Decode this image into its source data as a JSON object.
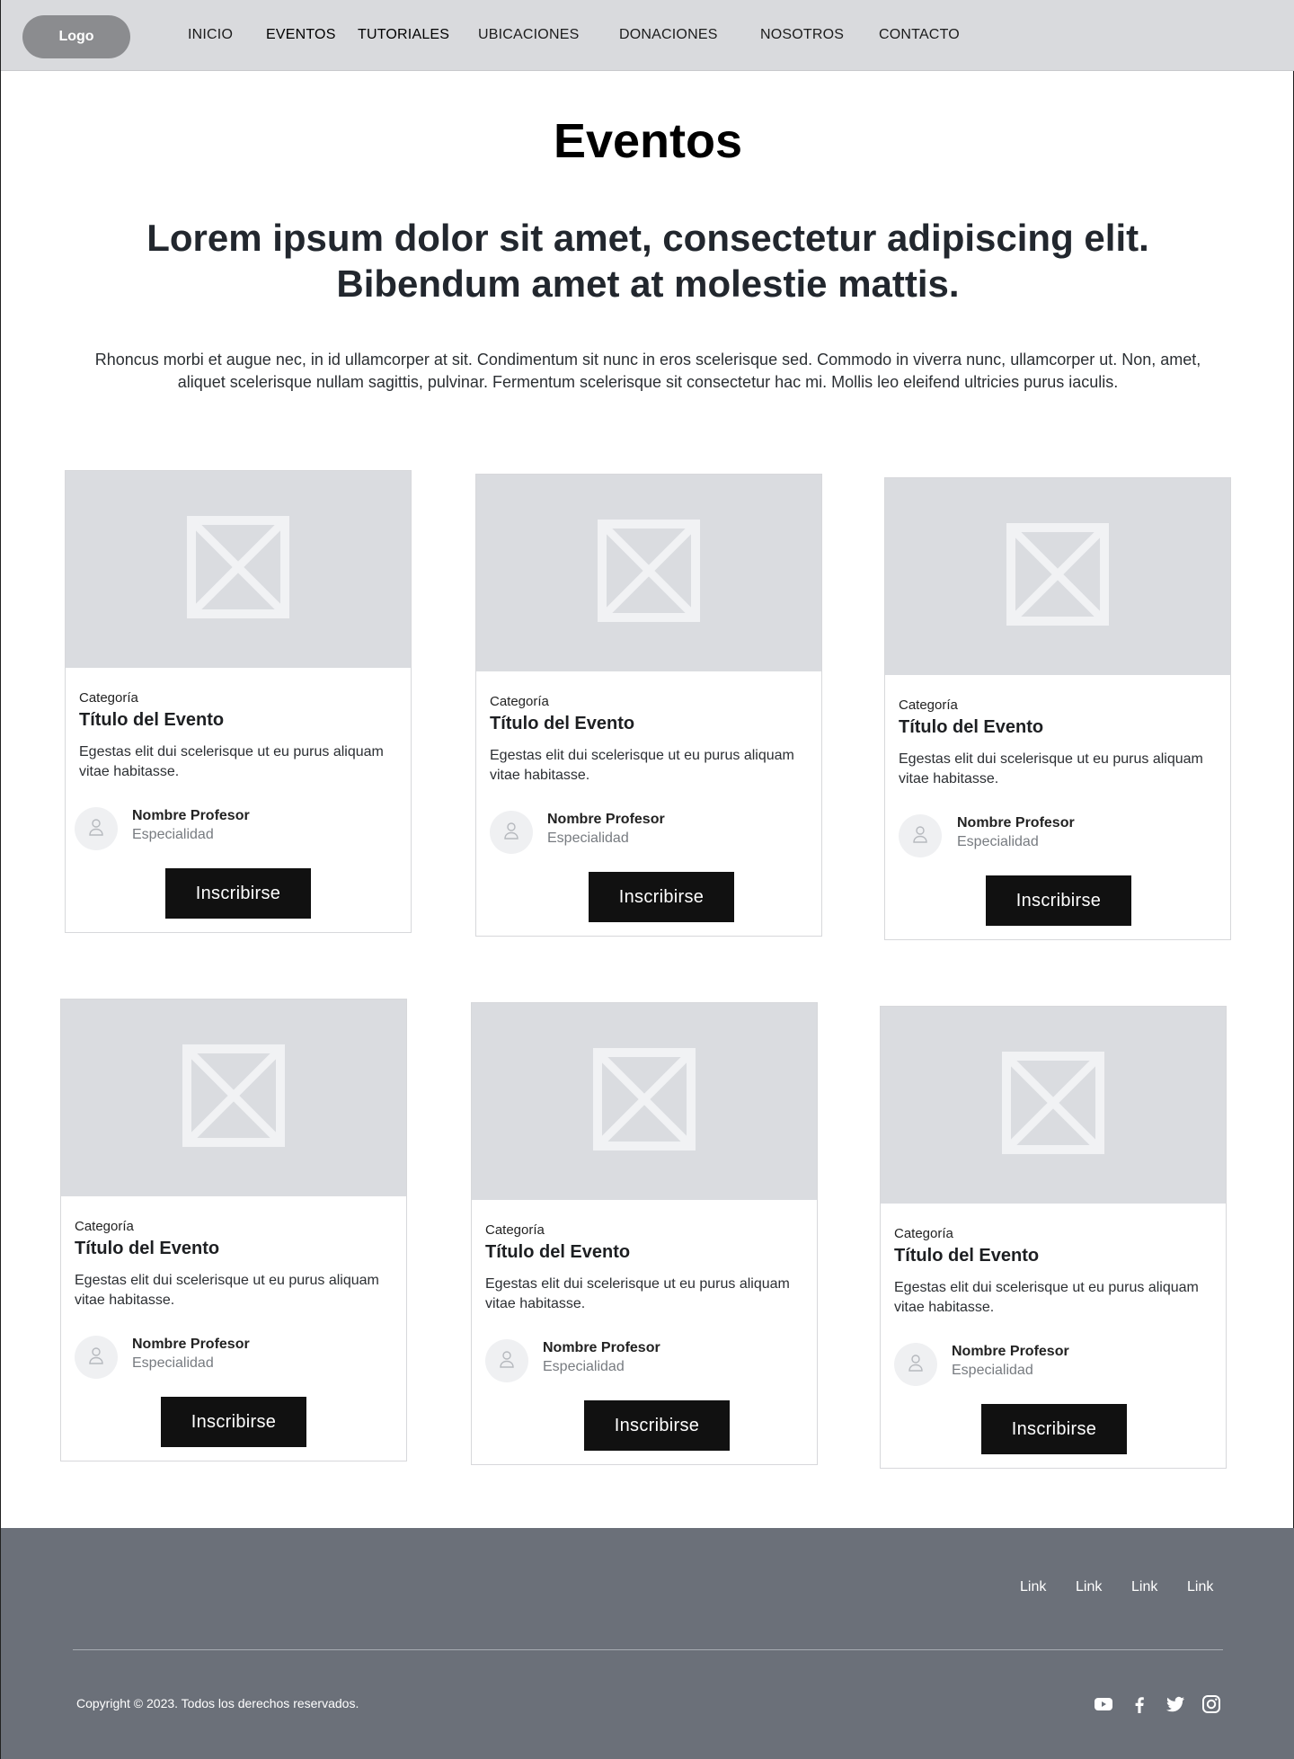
{
  "header": {
    "logo": "Logo",
    "nav": [
      "INICIO",
      "EVENTOS",
      "TUTORIALES",
      "UBICACIONES",
      "DONACIONES",
      "NOSOTROS",
      "CONTACTO"
    ]
  },
  "hero": {
    "title": "Eventos",
    "subtitle_line1": "Lorem ipsum dolor sit amet, consectetur adipiscing elit.",
    "subtitle_line2": "Bibendum amet at molestie mattis.",
    "intro_line1": "Rhoncus morbi et augue nec, in id ullamcorper at sit. Condimentum sit nunc in eros scelerisque sed. Commodo in viverra nunc, ullamcorper ut. Non, amet,",
    "intro_line2": "aliquet scelerisque nullam sagittis, pulvinar. Fermentum scelerisque sit consectetur hac mi. Mollis leo eleifend ultricies purus iaculis."
  },
  "cards": [
    {
      "category": "Categoría",
      "title": "Título del Evento",
      "desc_line1": "Egestas elit dui scelerisque ut eu purus aliquam",
      "desc_line2": "vitae habitasse.",
      "teacher": "Nombre Profesor",
      "specialty": "Especialidad",
      "button": "Inscribirse",
      "image_icon": "image-placeholder-icon",
      "avatar_icon": "user-icon"
    },
    {
      "category": "Categoría",
      "title": "Título del Evento",
      "desc_line1": "Egestas elit dui scelerisque ut eu purus aliquam",
      "desc_line2": "vitae habitasse.",
      "teacher": "Nombre Profesor",
      "specialty": "Especialidad",
      "button": "Inscribirse",
      "image_icon": "image-placeholder-icon",
      "avatar_icon": "user-icon"
    },
    {
      "category": "Categoría",
      "title": "Título del Evento",
      "desc_line1": "Egestas elit dui scelerisque ut eu purus aliquam",
      "desc_line2": "vitae habitasse.",
      "teacher": "Nombre Profesor",
      "specialty": "Especialidad",
      "button": "Inscribirse",
      "image_icon": "image-placeholder-icon",
      "avatar_icon": "user-icon"
    },
    {
      "category": "Categoría",
      "title": "Título del Evento",
      "desc_line1": "Egestas elit dui scelerisque ut eu purus aliquam",
      "desc_line2": "vitae habitasse.",
      "teacher": "Nombre Profesor",
      "specialty": "Especialidad",
      "button": "Inscribirse",
      "image_icon": "image-placeholder-icon",
      "avatar_icon": "user-icon"
    },
    {
      "category": "Categoría",
      "title": "Título del Evento",
      "desc_line1": "Egestas elit dui scelerisque ut eu purus aliquam",
      "desc_line2": "vitae habitasse.",
      "teacher": "Nombre Profesor",
      "specialty": "Especialidad",
      "button": "Inscribirse",
      "image_icon": "image-placeholder-icon",
      "avatar_icon": "user-icon"
    },
    {
      "category": "Categoría",
      "title": "Título del Evento",
      "desc_line1": "Egestas elit dui scelerisque ut eu purus aliquam",
      "desc_line2": "vitae habitasse.",
      "teacher": "Nombre Profesor",
      "specialty": "Especialidad",
      "button": "Inscribirse",
      "image_icon": "image-placeholder-icon",
      "avatar_icon": "user-icon"
    }
  ],
  "footer": {
    "links": [
      "Link",
      "Link",
      "Link",
      "Link"
    ],
    "copyright": "Copyright © 2023. Todos los derechos reservados.",
    "social_icons": [
      "youtube-icon",
      "facebook-icon",
      "twitter-icon",
      "instagram-icon"
    ]
  },
  "colors": {
    "header_bg": "#d9dadd",
    "logo_bg": "#8b8c8f",
    "image_placeholder": "#dadce0",
    "button_bg": "#111111",
    "footer_bg": "#6b7079"
  }
}
